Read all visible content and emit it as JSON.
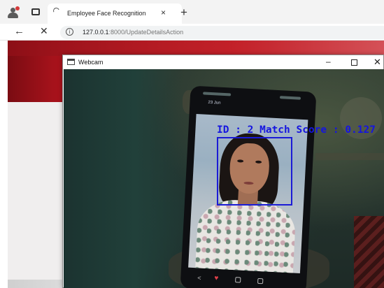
{
  "browser": {
    "tab_title": "Employee Face Recognition",
    "tab_close": "×",
    "new_tab": "+",
    "back": "←",
    "stop": "✕",
    "info": "i",
    "url_host": "127.0.0.1",
    "url_path": ":8000/UpdateDetailsAction"
  },
  "webcam_window": {
    "title": "Webcam",
    "minimize": "–",
    "close": "✕"
  },
  "phone": {
    "date": "23 Jun",
    "heart": "♥",
    "share": "<"
  },
  "detection": {
    "label": "ID : 2 Match Score : 0.127",
    "box_color": "#1b1bd6"
  },
  "colors": {
    "banner": "#c3161e",
    "overlay_text": "#1515e0"
  },
  "icons": [
    "profile-icon",
    "tab-actions-icon",
    "loading-icon",
    "info-icon",
    "webcam-app-icon"
  ]
}
